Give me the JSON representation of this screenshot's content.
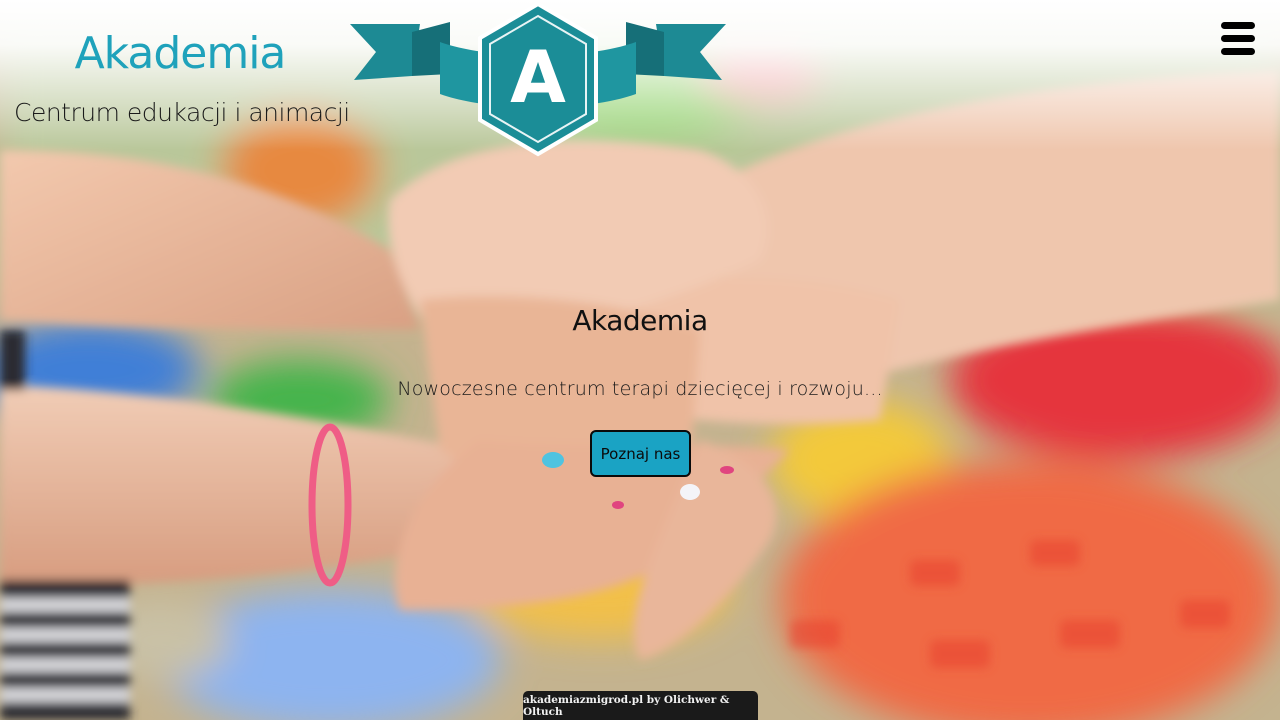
{
  "header": {
    "brand_title": "Akademia",
    "brand_subtitle": "Centrum edukacji i animacji",
    "logo_letter": "A",
    "menu_icon": "hamburger-menu-icon"
  },
  "hero": {
    "title": "Akademia",
    "tagline": "Nowoczesne centrum terapi dziecięcej i rozwoju...",
    "cta_label": "Poznaj nas",
    "background_image": "stacked-children-hands-photo"
  },
  "footer": {
    "credit": "akademiazmigrod.pl by Olichwer & Oltuch"
  },
  "colors": {
    "brand_teal": "#1fa2bb",
    "logo_teal": "#1d8a94",
    "cta_blue": "#1aa3c4",
    "footer_bg": "#1a1a1a"
  }
}
